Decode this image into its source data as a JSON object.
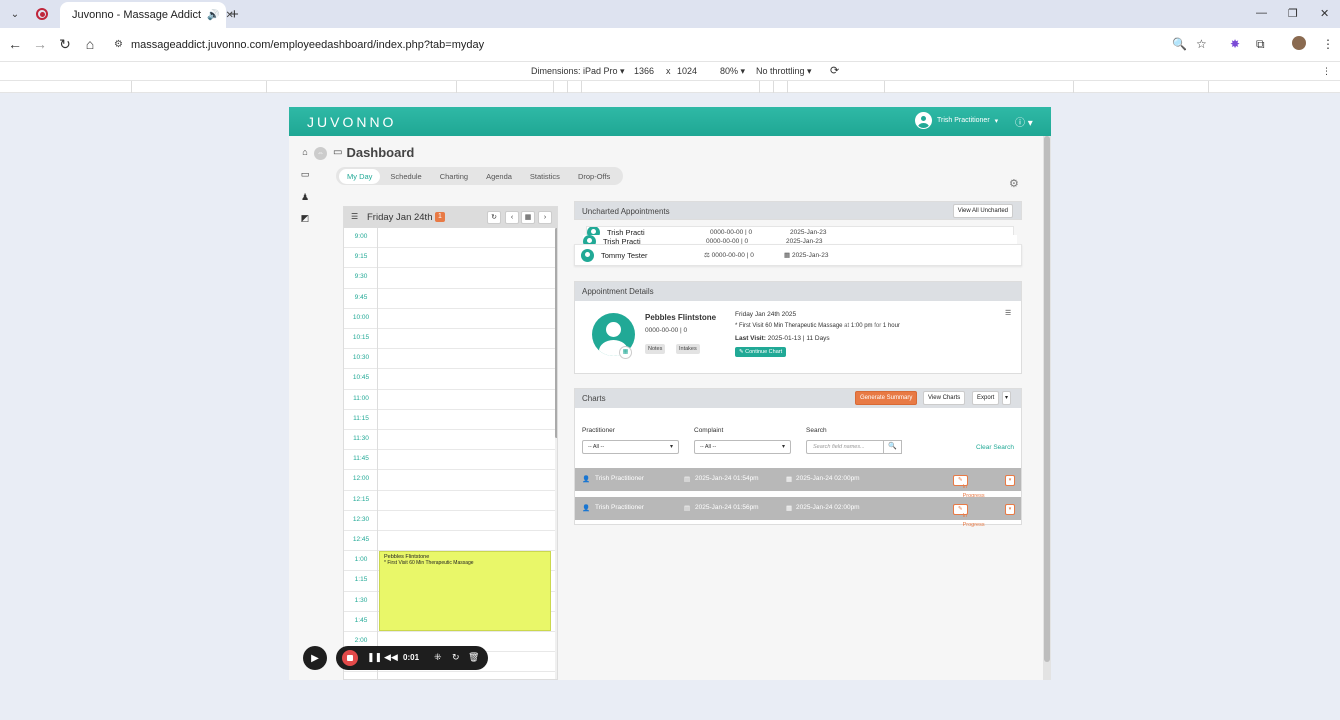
{
  "browser": {
    "tab_title": "Juvonno - Massage Addict",
    "url": "massageaddict.juvonno.com/employeedashboard/index.php?tab=myday"
  },
  "devtools": {
    "dimensions_label": "Dimensions: iPad Pro",
    "width": "1366",
    "times": "x",
    "height": "1024",
    "zoom": "80%",
    "throttling": "No throttling"
  },
  "app": {
    "logo": "JUVONNO",
    "user_name": "Trish Practitioner",
    "page_title": "Dashboard",
    "tabs": [
      "My Day",
      "Schedule",
      "Charting",
      "Agenda",
      "Statistics",
      "Drop-Offs"
    ],
    "active_tab": "My Day"
  },
  "calendar": {
    "date": "Friday Jan 24th",
    "badge": "1",
    "times": [
      "9:00",
      "9:15",
      "9:30",
      "9:45",
      "10:00",
      "10:15",
      "10:30",
      "10:45",
      "11:00",
      "11:15",
      "11:30",
      "11:45",
      "12:00",
      "12:15",
      "12:30",
      "12:45",
      "1:00",
      "1:15",
      "1:30",
      "1:45",
      "2:00",
      "2:15"
    ],
    "appointment": {
      "name": "Pebbles Flintstone",
      "desc": "* First Visit 60 Min Therapeutic Massage"
    }
  },
  "uncharted": {
    "title": "Uncharted Appointments",
    "view_all": "View All Uncharted",
    "rows": [
      {
        "name": "Trish Practi",
        "meta": "0000-00-00 | 0",
        "date": "2025-Jan-23"
      },
      {
        "name": "Trish Practi",
        "meta": "0000-00-00 | 0",
        "date": "2025-Jan-23"
      },
      {
        "name": "Tommy Tester",
        "meta": "0000-00-00 | 0",
        "date": "2025-Jan-23"
      }
    ]
  },
  "details": {
    "title": "Appointment Details",
    "name": "Pebbles Flintstone",
    "phone": "0000-00-00 | 0",
    "tag_notes": "Notes",
    "tag_intakes": "Intakes",
    "date": "Friday Jan 24th 2025",
    "visit_main": "* First Visit 60 Min Therapeutic Massage",
    "visit_at": "at",
    "visit_time": "1:00 pm",
    "visit_for": "for",
    "visit_duration": "1 hour",
    "last_visit_label": "Last Visit:",
    "last_visit_value": "2025-01-13 | 11 Days",
    "continue_chart": "Continue Chart"
  },
  "charts": {
    "title": "Charts",
    "generate_summary": "Generate Summary",
    "view_charts": "View Charts",
    "export": "Export",
    "practitioner_label": "Practitioner",
    "practitioner_value": "-- All --",
    "complaint_label": "Complaint",
    "complaint_value": "-- All --",
    "search_label": "Search",
    "search_placeholder": "Search field names...",
    "clear_search": "Clear Search",
    "rows": [
      {
        "practitioner": "Trish Practitioner",
        "created": "2025-Jan-24 01:54pm",
        "appt": "2025-Jan-24 02:00pm",
        "status": "In Progress"
      },
      {
        "practitioner": "Trish Practitioner",
        "created": "2025-Jan-24 01:56pm",
        "appt": "2025-Jan-24 02:00pm",
        "status": "In Progress"
      }
    ]
  },
  "recorder": {
    "time": "0:01"
  }
}
